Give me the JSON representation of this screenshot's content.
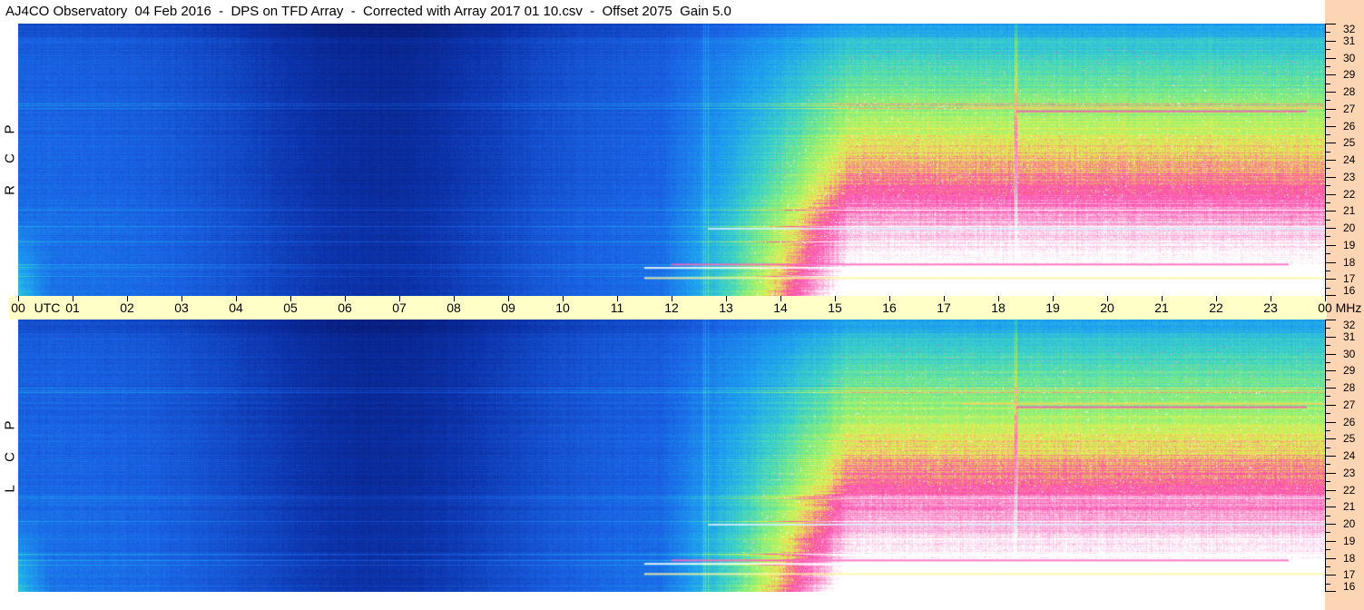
{
  "header": {
    "title": "AJ4CO Observatory  04 Feb 2016  -  DPS on TFD Array  -  Corrected with Array 2017 01 10.csv  -  Offset 2075  Gain 5.0"
  },
  "panels": [
    {
      "label_letters": [
        "P",
        "C",
        "R"
      ]
    },
    {
      "label_letters": [
        "P",
        "C",
        "L"
      ]
    }
  ],
  "time_axis": {
    "labels": [
      "00",
      "UTC",
      "01",
      "02",
      "03",
      "04",
      "05",
      "06",
      "07",
      "08",
      "09",
      "10",
      "11",
      "12",
      "13",
      "14",
      "15",
      "16",
      "17",
      "18",
      "19",
      "20",
      "21",
      "22",
      "23",
      "00",
      "MHz"
    ]
  },
  "chart_data": [
    {
      "type": "heatmap",
      "title": "R C P",
      "x": [
        "00",
        "01",
        "02",
        "03",
        "04",
        "05",
        "06",
        "07",
        "08",
        "09",
        "10",
        "11",
        "12",
        "13",
        "14",
        "15",
        "16",
        "17",
        "18",
        "19",
        "20",
        "21",
        "22",
        "23",
        "00"
      ],
      "x_unit": "UTC",
      "y": [
        16,
        17,
        18,
        19,
        20,
        21,
        22,
        23,
        24,
        25,
        26,
        27,
        28,
        29,
        30,
        31,
        32
      ],
      "y_unit": "MHz",
      "ylim": [
        16,
        32
      ],
      "colors": {
        "low": "#08207a",
        "mid": "#1a6ee8",
        "high": "#5ce0a0",
        "peak": "#ff3090"
      }
    },
    {
      "type": "heatmap",
      "title": "L C P",
      "x": [
        "00",
        "01",
        "02",
        "03",
        "04",
        "05",
        "06",
        "07",
        "08",
        "09",
        "10",
        "11",
        "12",
        "13",
        "14",
        "15",
        "16",
        "17",
        "18",
        "19",
        "20",
        "21",
        "22",
        "23",
        "00"
      ],
      "x_unit": "UTC",
      "y": [
        16,
        17,
        18,
        19,
        20,
        21,
        22,
        23,
        24,
        25,
        26,
        27,
        28,
        29,
        30,
        31,
        32
      ],
      "y_unit": "MHz",
      "ylim": [
        16,
        32
      ],
      "colors": {
        "low": "#08207a",
        "mid": "#1a6ee8",
        "high": "#5ce0a0",
        "peak": "#ff3090"
      }
    }
  ],
  "colors": {
    "time_bar": "#ffffc8",
    "freq_column": "#fcd6b4"
  }
}
